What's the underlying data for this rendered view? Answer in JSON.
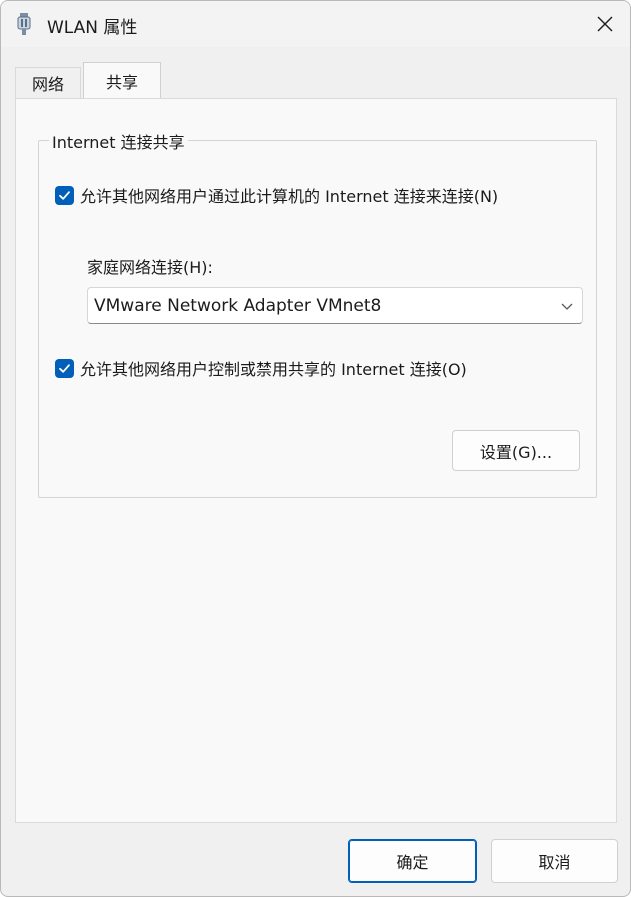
{
  "window": {
    "title": "WLAN 属性",
    "close_icon": "close-icon",
    "app_icon": "network-adapter-icon"
  },
  "tabs": [
    {
      "label": "网络",
      "active": false
    },
    {
      "label": "共享",
      "active": true
    }
  ],
  "sharing": {
    "group_title": "Internet 连接共享",
    "allow_connect": {
      "label": "允许其他网络用户通过此计算机的 Internet 连接来连接(N)",
      "checked": true
    },
    "home_network_label": "家庭网络连接(H):",
    "home_network_value": "VMware Network Adapter VMnet8",
    "allow_control": {
      "label": "允许其他网络用户控制或禁用共享的 Internet 连接(O)",
      "checked": true
    },
    "settings_button": "设置(G)..."
  },
  "footer": {
    "ok_button": "确定",
    "cancel_button": "取消"
  },
  "colors": {
    "accent": "#005fb8",
    "dialog_bg": "#f0f0f0",
    "panel_bg": "#f9f9f9"
  }
}
